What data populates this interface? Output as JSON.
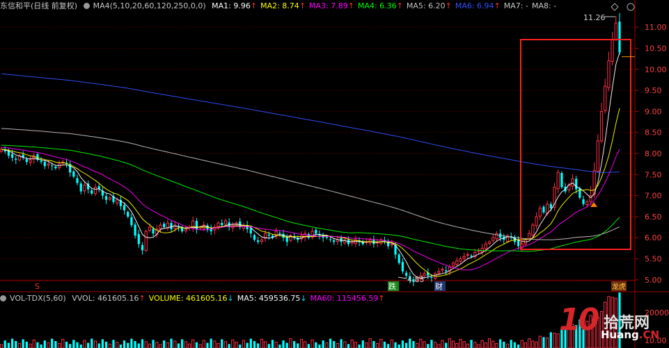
{
  "header": {
    "title": "东信和平(日线 前复权)",
    "indicator": "MA4(5,10,20,60,120,250,0,0)",
    "ma": [
      {
        "label": "MA1: 9.96",
        "color": "#ffffff",
        "arrow": "↑"
      },
      {
        "label": "MA2: 8.74",
        "color": "#ffff00",
        "arrow": "↑"
      },
      {
        "label": "MA3: 7.89",
        "color": "#ff00ff",
        "arrow": "↑"
      },
      {
        "label": "MA4: 6.36",
        "color": "#00ff00",
        "arrow": "↑"
      },
      {
        "label": "MA5: 6.20",
        "color": "#c0c0c0",
        "arrow": "↑"
      },
      {
        "label": "MA6: 6.94",
        "color": "#3050ff",
        "arrow": "↑"
      },
      {
        "label": "MA7: -",
        "color": "#c8c8c8",
        "arrow": ""
      },
      {
        "label": "MA8: -",
        "color": "#c8c8c8",
        "arrow": ""
      }
    ]
  },
  "price_axis": {
    "ticks": [
      "11.00",
      "10.50",
      "10.00",
      "9.50",
      "9.00",
      "8.50",
      "8.00",
      "7.50",
      "7.00",
      "6.50",
      "6.00",
      "5.50",
      "5.00"
    ],
    "tick_values": [
      11.0,
      10.5,
      10.0,
      9.5,
      9.0,
      8.5,
      8.0,
      7.5,
      7.0,
      6.5,
      6.0,
      5.5,
      5.0
    ],
    "current_price": "10.30"
  },
  "annotations": {
    "high_label": "11.26",
    "low_label": "4.83",
    "markers": [
      "S",
      "跌",
      "财",
      "龙虎"
    ]
  },
  "volume_header": {
    "title": "VOL-TDX(5,60)",
    "items": [
      {
        "label": "VVOL: 461605.16",
        "color": "#c8c8c8",
        "arrow": "↑"
      },
      {
        "label": "VOLUME: 461605.16",
        "color": "#ffff00",
        "arrow": "↓"
      },
      {
        "label": "MA5: 459536.75",
        "color": "#ffffff",
        "arrow": "↓"
      },
      {
        "label": "MA60: 115456.59",
        "color": "#ff00ff",
        "arrow": "↑"
      }
    ]
  },
  "volume_axis": {
    "ticks": [
      "200000",
      "10.00"
    ]
  },
  "watermark": {
    "brand": "10",
    "cn": "拾荒网",
    "url_a": "Huang",
    "url_b": ".CN"
  },
  "colors": {
    "up": "#ff3048",
    "down": "#00ffff",
    "box": "#ff2020",
    "grid": "#800000"
  },
  "chart_data": {
    "type": "candlestick",
    "title": "东信和平(日线 前复权)",
    "ylim": [
      4.75,
      11.35
    ],
    "closes": [
      8.1,
      8.05,
      7.95,
      7.9,
      7.85,
      7.95,
      7.9,
      7.8,
      7.85,
      7.95,
      7.85,
      7.8,
      7.7,
      7.75,
      7.7,
      7.65,
      7.75,
      7.8,
      7.75,
      7.55,
      7.45,
      7.3,
      7.1,
      7.25,
      7.15,
      7.05,
      7.2,
      7.15,
      7.0,
      6.9,
      6.95,
      6.85,
      6.9,
      6.75,
      6.65,
      6.5,
      6.3,
      6.05,
      5.85,
      5.7,
      6.15,
      6.25,
      6.1,
      6.2,
      6.3,
      6.25,
      6.35,
      6.2,
      6.3,
      6.25,
      6.15,
      6.2,
      6.25,
      6.4,
      6.2,
      6.25,
      6.3,
      6.2,
      6.15,
      6.25,
      6.35,
      6.3,
      6.4,
      6.25,
      6.3,
      6.35,
      6.25,
      6.3,
      6.2,
      6.1,
      5.95,
      5.9,
      5.95,
      6.1,
      6.05,
      6.0,
      6.15,
      6.1,
      6.0,
      5.9,
      6.05,
      6.0,
      5.95,
      6.05,
      6.1,
      6.0,
      6.15,
      6.1,
      6.05,
      6.0,
      6.0,
      5.95,
      5.9,
      5.95,
      5.9,
      5.95,
      5.85,
      5.9,
      5.95,
      5.9,
      5.85,
      5.9,
      5.95,
      5.85,
      5.9,
      5.95,
      5.9,
      5.8,
      5.85,
      5.6,
      5.4,
      5.2,
      5.1,
      5.0,
      4.95,
      5.05,
      5.1,
      5.15,
      5.1,
      5.05,
      5.15,
      5.2,
      5.25,
      5.2,
      5.3,
      5.4,
      5.45,
      5.5,
      5.55,
      5.6,
      5.55,
      5.65,
      5.7,
      5.75,
      5.85,
      5.9,
      6.0,
      6.1,
      6.0,
      5.95,
      6.05,
      6.0,
      5.9,
      5.8,
      5.85,
      5.95,
      6.1,
      6.3,
      6.5,
      6.7,
      6.6,
      6.8,
      6.7,
      7.2,
      7.55,
      7.2,
      7.1,
      7.25,
      7.4,
      7.15,
      6.95,
      6.8,
      6.85,
      7.0,
      7.6,
      8.3,
      9.0,
      9.6,
      10.2,
      10.7,
      11.1,
      10.4
    ],
    "ma_series": [
      {
        "name": "MA1",
        "color": "#ffffff",
        "last": 9.96
      },
      {
        "name": "MA2",
        "color": "#ffff00",
        "last": 8.74
      },
      {
        "name": "MA3",
        "color": "#ff00ff",
        "last": 7.89
      },
      {
        "name": "MA4",
        "color": "#00ff00",
        "last": 6.36
      },
      {
        "name": "MA5",
        "color": "#c0c0c0",
        "last": 6.2
      },
      {
        "name": "MA6",
        "color": "#3050ff",
        "last": 6.94
      }
    ],
    "volume": {
      "ylim": [
        0,
        250000
      ]
    }
  }
}
